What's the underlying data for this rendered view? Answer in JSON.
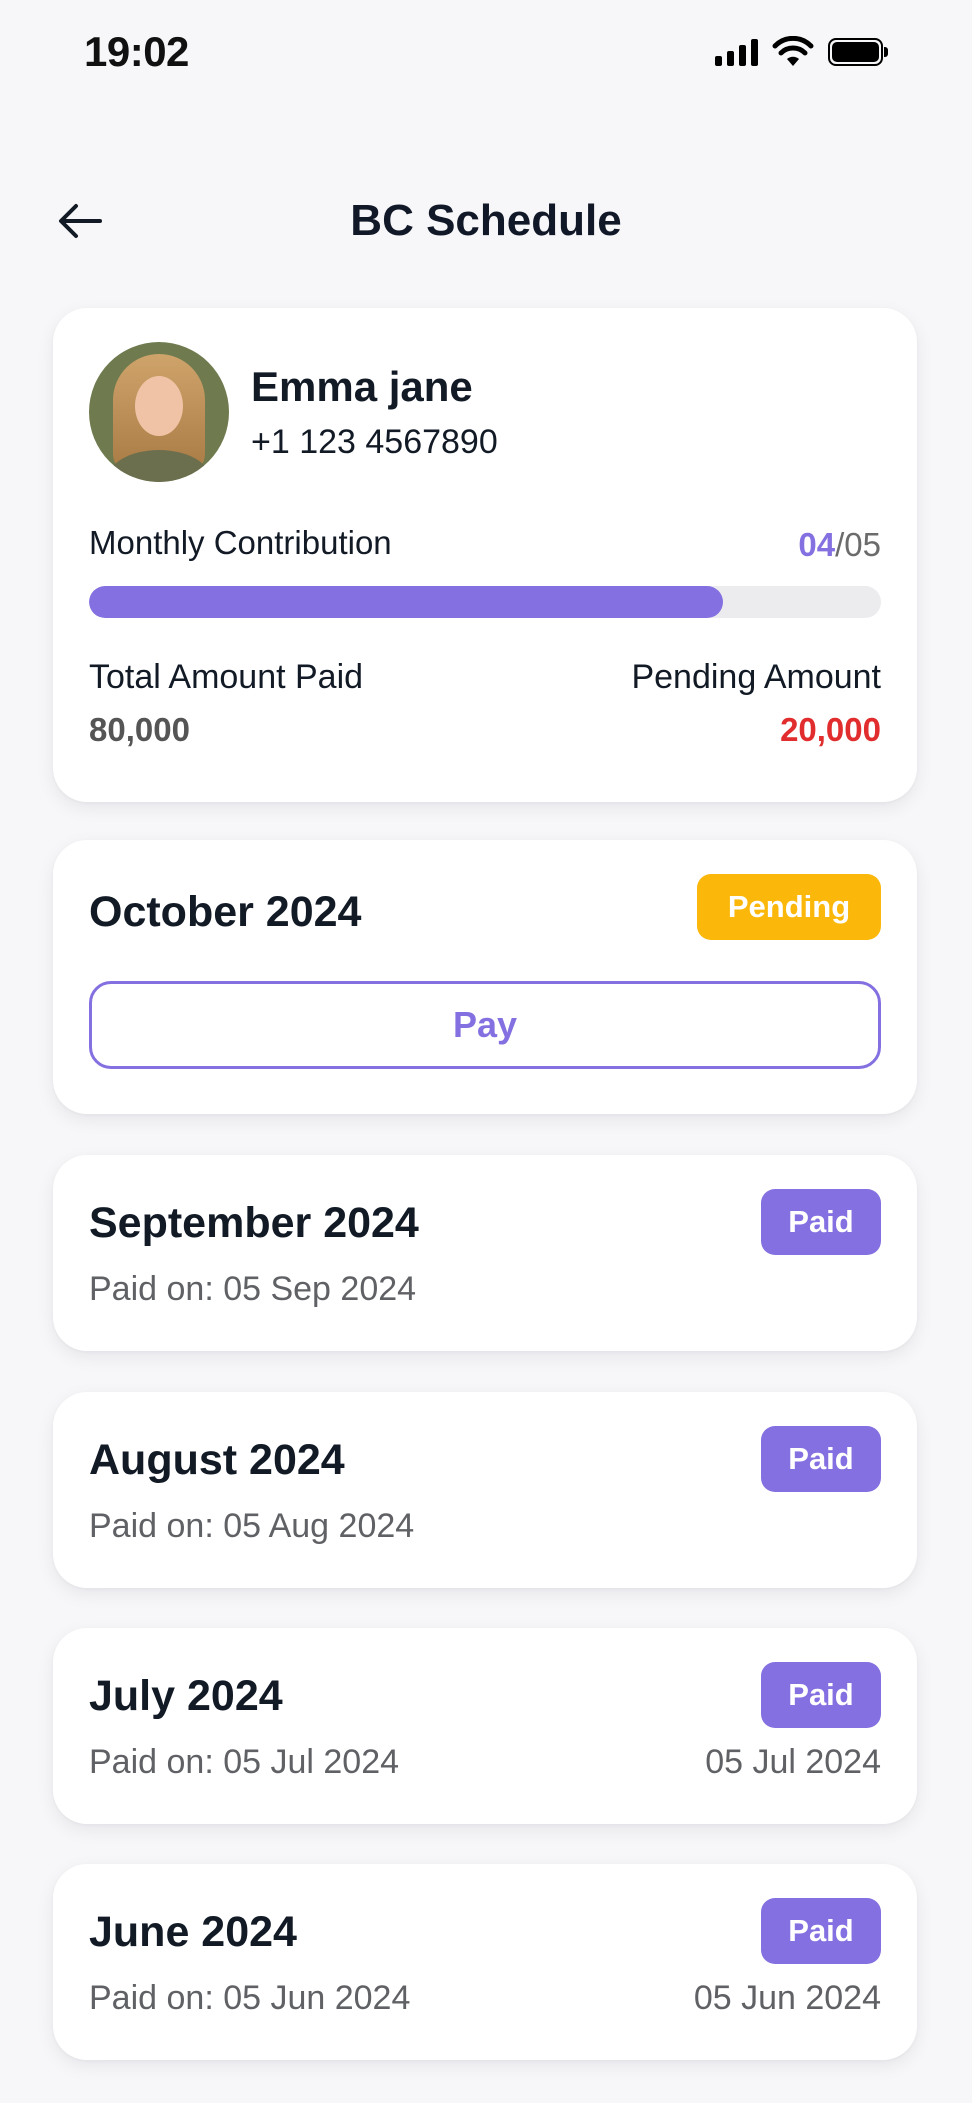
{
  "status_bar": {
    "time": "19:02"
  },
  "header": {
    "title": "BC Schedule",
    "back_icon": "arrow-left-icon"
  },
  "profile": {
    "name": "Emma jane",
    "phone": "+1 123 4567890",
    "contribution_label": "Monthly Contribution",
    "contribution_current": "04",
    "contribution_total": "/05",
    "progress_fraction": 0.8,
    "total_paid_label": "Total Amount Paid",
    "total_paid_value": "80,000",
    "pending_label": "Pending Amount",
    "pending_value": "20,000"
  },
  "colors": {
    "accent": "#8470e0",
    "pending": "#fbb70a",
    "danger": "#e12d2d"
  },
  "months": [
    {
      "title": "October 2024",
      "status": "Pending",
      "action": "Pay"
    },
    {
      "title": "September 2024",
      "status": "Paid",
      "paid_on": "Paid on: 05 Sep 2024",
      "right_date": ""
    },
    {
      "title": "August 2024",
      "status": "Paid",
      "paid_on": "Paid on: 05 Aug 2024",
      "right_date": ""
    },
    {
      "title": "July 2024",
      "status": "Paid",
      "paid_on": "Paid on: 05 Jul 2024",
      "right_date": "05 Jul 2024"
    },
    {
      "title": "June 2024",
      "status": "Paid",
      "paid_on": "Paid on: 05 Jun 2024",
      "right_date": "05 Jun 2024"
    }
  ]
}
